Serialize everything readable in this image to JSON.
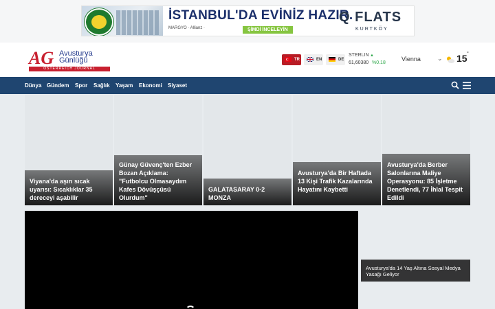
{
  "ad": {
    "headline": "İSTANBUL'DA EVİNİZ HAZIR.",
    "sponsors": "MARGYO    ·    Allianz    ·",
    "cta": "ŞİMDİ İNCELEYİN",
    "brand": "Q FLATS",
    "brand_sub": "KURTKÖY"
  },
  "header": {
    "logo_mark": "AG",
    "logo_line1": "Avusturya",
    "logo_line2": "Günlüğü",
    "logo_sub": "ÖSTERREICH JOURNAL",
    "languages": [
      {
        "code": "TR",
        "active": true
      },
      {
        "code": "EN",
        "active": false
      },
      {
        "code": "DE",
        "active": false
      }
    ],
    "currency": {
      "name": "STERLIN",
      "value": "61,60380",
      "change": "%0.18"
    },
    "weather": {
      "city": "Vienna",
      "temp": "15",
      "unit": "°"
    }
  },
  "nav": {
    "items": [
      "Dünya",
      "Gündem",
      "Spor",
      "Sağlık",
      "Yaşam",
      "Ekonomi",
      "Siyaset"
    ]
  },
  "cards": [
    {
      "title": "Viyana'da aşırı sıcak uyarısı: Sıcaklıklar 35 dereceyi aşabilir"
    },
    {
      "title": "Günay Güvenç'ten Ezber Bozan Açıklama: \"Futbolcu Olmasaydım Kafes Dövüşçüsü Olurdum\""
    },
    {
      "title": "GALATASARAY 0-2 MONZA"
    },
    {
      "title": "Avusturya'da Bir Haftada 13 Kişi Trafik Kazalarında Hayatını Kaybetti"
    },
    {
      "title": "Avusturya'da Berber Salonlarına Maliye Operasyonu: 85 İşletme Denetlendi, 77 İhlal Tespit Edildi"
    }
  ],
  "side_card": {
    "title": "Avusturya'da 14 Yaş Altına Sosyal Medya Yasağı Geliyor"
  },
  "colors": {
    "nav": "#1f4570",
    "brand_red": "#c8202f",
    "positive": "#2ea84a"
  }
}
